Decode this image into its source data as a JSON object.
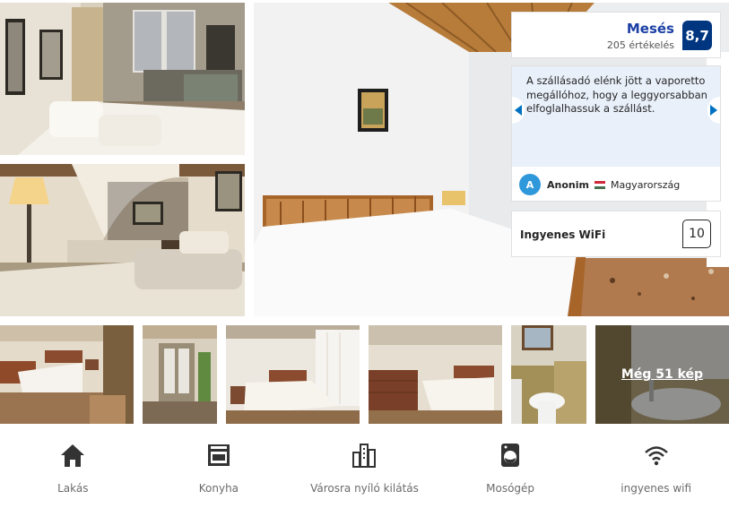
{
  "rating": {
    "label": "Mesés",
    "review_count": "205 értékelés",
    "score": "8,7",
    "badge_color": "#003580"
  },
  "review": {
    "text": "A szállásadó elénk jött a vaporetto megállóhoz, hogy a leggyorsabban elfoglalhassuk a szállást.",
    "avatar_letter": "A",
    "reviewer_name": "Anonim",
    "reviewer_country": "Magyarország",
    "flag_icon": "hungary-flag-icon",
    "prev_icon": "chevron-left-icon",
    "next_icon": "chevron-right-icon"
  },
  "subscore": {
    "label": "Ingyenes WiFi",
    "score": "10"
  },
  "gallery": {
    "more_photos_label": "Még 51 kép"
  },
  "amenities": [
    {
      "label": "Lakás",
      "icon": "house-icon"
    },
    {
      "label": "Konyha",
      "icon": "oven-icon"
    },
    {
      "label": "Városra nyíló kilátás",
      "icon": "city-view-icon"
    },
    {
      "label": "Mosógép",
      "icon": "washing-machine-icon"
    },
    {
      "label": "ingyenes wifi",
      "icon": "wifi-icon"
    }
  ]
}
